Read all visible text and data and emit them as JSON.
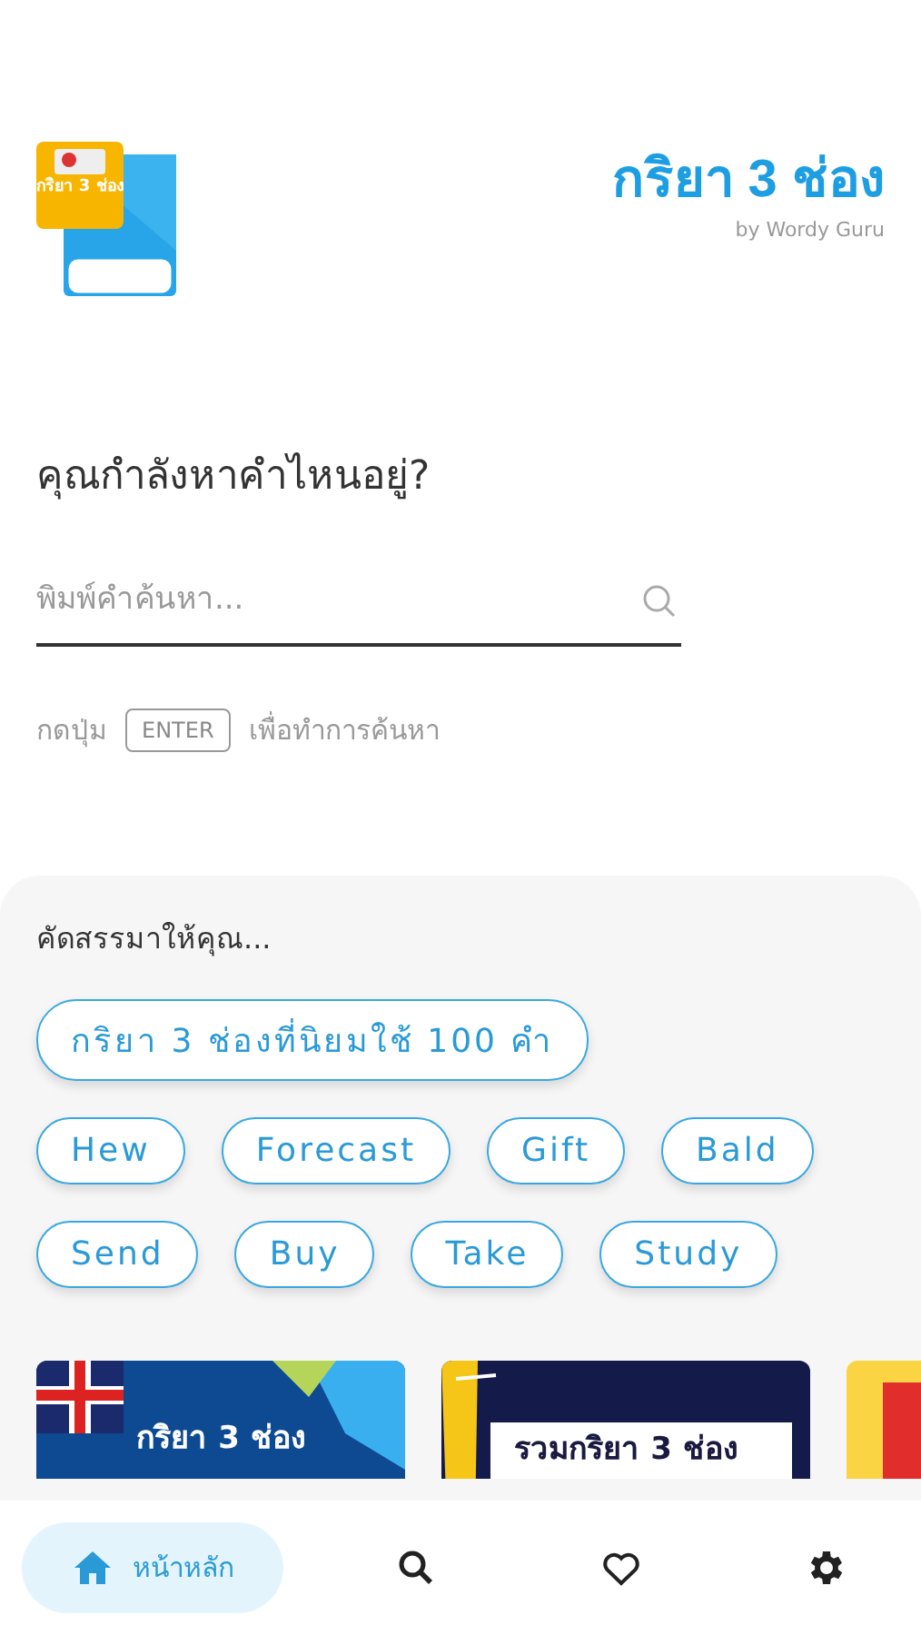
{
  "header": {
    "logo_label": "กริยา 3 ช่อง",
    "title": "กริยา 3 ช่อง",
    "subtitle": "by Wordy Guru"
  },
  "search": {
    "heading": "คุณกำลังหาคำไหนอยู่?",
    "placeholder": "พิมพ์คำค้นหา...",
    "hint_before": "กดปุ่ม",
    "key": "ENTER",
    "hint_after": "เพื่อทำการค้นหา"
  },
  "suggestions": {
    "title": "คัดสรรมาให้คุณ...",
    "rows": [
      [
        "กริยา 3 ช่องที่นิยมใช้ 100 คำ"
      ],
      [
        "Hew",
        "Forecast",
        "Gift",
        "Bald"
      ],
      [
        "Send",
        "Buy",
        "Take",
        "Study"
      ]
    ]
  },
  "cards": [
    {
      "kind": "flag",
      "title": "กริยา 3 ช่อง"
    },
    {
      "kind": "banner",
      "title": "รวมกริยา 3 ช่อง"
    },
    {
      "kind": "red"
    }
  ],
  "nav": [
    {
      "kind": "home",
      "label": "หน้าหลัก",
      "selected": true
    },
    {
      "kind": "search",
      "selected": false
    },
    {
      "kind": "favorites",
      "selected": false
    },
    {
      "kind": "settings",
      "selected": false
    }
  ]
}
